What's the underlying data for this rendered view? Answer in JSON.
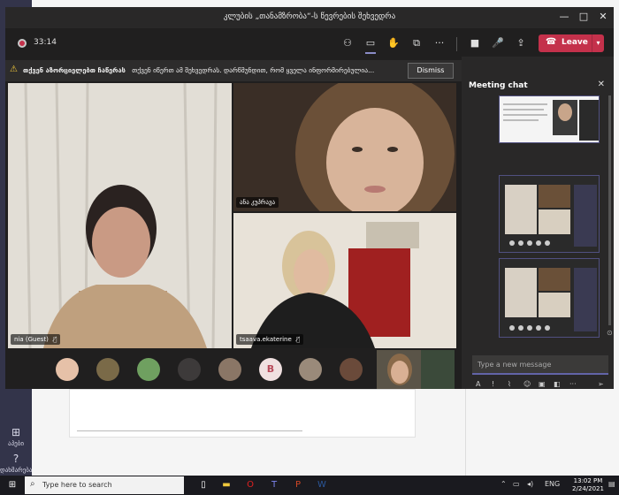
{
  "window": {
    "title": "კლუბის „თანამზრობა“-ს წევრების შეხვედრა",
    "minimize": "—",
    "maximize": "□",
    "close": "✕"
  },
  "call": {
    "timer": "33:14",
    "leave_label": "Leave",
    "icons": [
      "participants-icon",
      "chat-icon",
      "reactions-icon",
      "layout-icon",
      "more-icon",
      "camera-icon",
      "mic-icon",
      "share-icon"
    ]
  },
  "banner": {
    "bold": "თქვენ აზორციელებთ ჩაწერას",
    "text": "თქვენ იწერთ ამ შეხვედრას. დარწმუნდით, რომ ყველა ინფორმირებულია...",
    "dismiss_label": "Dismiss"
  },
  "participants": [
    {
      "name": "nia (Guest)"
    },
    {
      "name": "ანა კუპრავა"
    },
    {
      "name": "tsaava.ekaterine"
    }
  ],
  "avatar_letter": "B",
  "chat": {
    "title": "Meeting chat",
    "placeholder": "Type a new message",
    "close": "✕"
  },
  "rail": [
    {
      "icon": "apps-icon",
      "label": "აპები"
    },
    {
      "icon": "help-icon",
      "label": "დახმარება"
    }
  ],
  "taskbar": {
    "search_placeholder": "Type here to search",
    "time": "13:02 PM",
    "date": "2/24/2021",
    "lang": "ENG"
  },
  "colors": {
    "accent": "#6264a7",
    "leave": "#c4314b",
    "warning": "#f0c83c"
  }
}
